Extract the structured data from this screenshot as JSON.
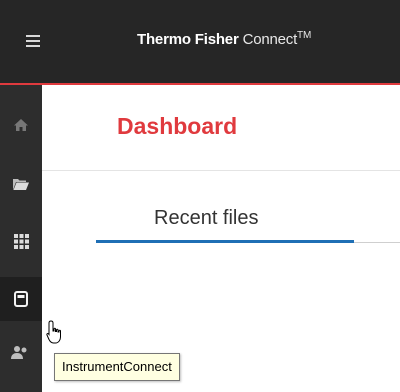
{
  "header": {
    "brand_bold": "Thermo Fisher",
    "brand_light": "Connect",
    "trademark": "TM"
  },
  "sidebar": {
    "items": [
      {
        "icon": "home-icon"
      },
      {
        "icon": "folder-icon"
      },
      {
        "icon": "apps-grid-icon"
      },
      {
        "icon": "instrument-icon",
        "active": true
      },
      {
        "icon": "users-icon"
      }
    ]
  },
  "main": {
    "title": "Dashboard",
    "tabs": [
      {
        "label": "Recent files",
        "active": true
      }
    ]
  },
  "tooltip": {
    "text": "InstrumentConnect"
  },
  "colors": {
    "accent_red": "#e03a3e",
    "tab_blue": "#1f6fb5",
    "topbar": "#262626",
    "sidebar": "#2d2d2d"
  }
}
